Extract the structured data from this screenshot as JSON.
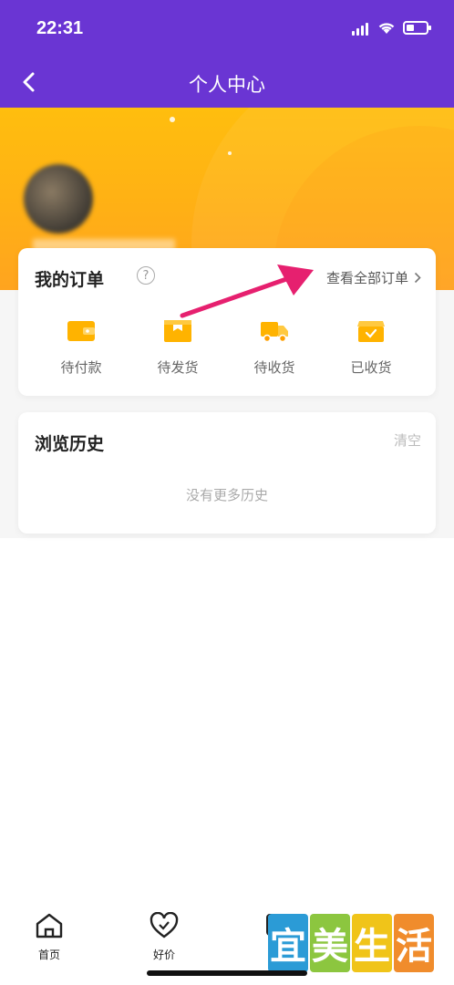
{
  "status_bar": {
    "time": "22:31",
    "battery_level": 0.4
  },
  "nav": {
    "title": "个人中心",
    "back_icon": "chevron-left-icon"
  },
  "orders": {
    "title": "我的订单",
    "help_icon": "?",
    "view_all": "查看全部订单",
    "items": [
      {
        "label": "待付款",
        "icon": "wallet-icon"
      },
      {
        "label": "待发货",
        "icon": "package-icon"
      },
      {
        "label": "待收货",
        "icon": "truck-icon"
      },
      {
        "label": "已收货",
        "icon": "box-check-icon"
      }
    ]
  },
  "history": {
    "title": "浏览历史",
    "clear": "清空",
    "empty": "没有更多历史"
  },
  "tabbar": {
    "items": [
      {
        "label": "首页",
        "icon": "home-icon"
      },
      {
        "label": "好价",
        "icon": "heart-icon"
      }
    ]
  },
  "watermark": {
    "chars": [
      "宜",
      "美",
      "生",
      "活"
    ],
    "colors": [
      "#2b9bd6",
      "#8cc63f",
      "#f0c419",
      "#f08c2c"
    ]
  },
  "colors": {
    "header": "#6a35d3",
    "accent": "#ffb015",
    "arrow": "#e6206f"
  }
}
